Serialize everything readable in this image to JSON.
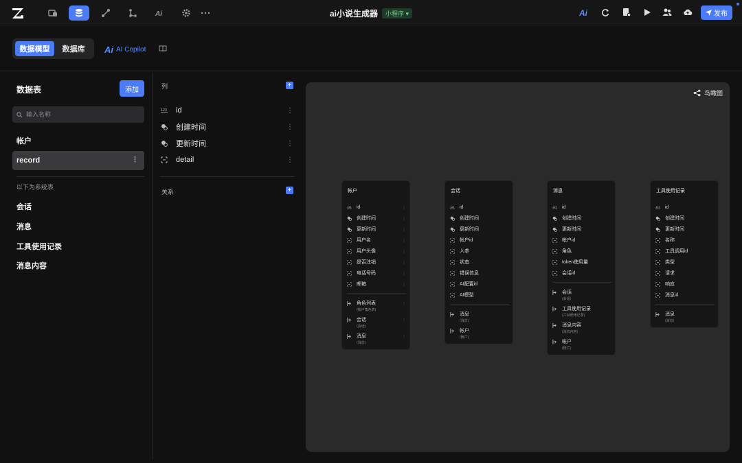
{
  "app": {
    "title": "ai小说生成器",
    "badge": "小程序 ▾",
    "publish": "发布"
  },
  "nav_icons": [
    "pages-icon",
    "database-icon",
    "workflow-icon",
    "logic-icon",
    "ai-icon",
    "settings-icon",
    "more-icon"
  ],
  "subbar": {
    "tab_model": "数据模型",
    "tab_db": "数据库",
    "copilot_ai": "Ai",
    "copilot": "AI Copilot"
  },
  "left": {
    "title": "数据表",
    "add": "添加",
    "search_placeholder": "输入名称",
    "tables": [
      "帐户",
      "record"
    ],
    "system_label": "以下为系统表",
    "system_tables": [
      "会话",
      "消息",
      "工具使用记录",
      "消息内容"
    ]
  },
  "middle": {
    "columns_label": "列",
    "relations_label": "关系",
    "columns": [
      {
        "icon": "number-icon",
        "name": "id"
      },
      {
        "icon": "clock-icon",
        "name": "创建时间"
      },
      {
        "icon": "clock-icon",
        "name": "更新时间"
      },
      {
        "icon": "field-icon",
        "name": "detail"
      }
    ]
  },
  "canvas": {
    "birdview": "鸟瞰图",
    "cards": [
      {
        "title": "帐户",
        "fields": [
          "id",
          "创建时间",
          "更新时间",
          "用户名",
          "用户头像",
          "是否注销",
          "电话号码",
          "邮箱"
        ],
        "relations": [
          {
            "name": "角色列表",
            "sub": "(帐户角色表)"
          },
          {
            "name": "会话",
            "sub": "(会话)"
          },
          {
            "name": "消息",
            "sub": "(消息)"
          }
        ]
      },
      {
        "title": "会话",
        "fields": [
          "id",
          "创建时间",
          "更新时间",
          "帐户id",
          "入参",
          "状态",
          "错误信息",
          "AI配置id",
          "AI模型"
        ],
        "relations": [
          {
            "name": "消息",
            "sub": "(消息)"
          },
          {
            "name": "帐户",
            "sub": "(帐户)"
          }
        ]
      },
      {
        "title": "消息",
        "fields": [
          "id",
          "创建时间",
          "更新时间",
          "帐户id",
          "角色",
          "token使用量",
          "会话id"
        ],
        "relations": [
          {
            "name": "会话",
            "sub": "(会话)"
          },
          {
            "name": "工具使用记录",
            "sub": "(工具使用记录)"
          },
          {
            "name": "消息内容",
            "sub": "(消息内容)"
          },
          {
            "name": "帐户",
            "sub": "(帐户)"
          }
        ]
      },
      {
        "title": "工具使用记录",
        "fields": [
          "id",
          "创建时间",
          "更新时间",
          "名称",
          "工具调用id",
          "类型",
          "请求",
          "响应",
          "消息id"
        ],
        "relations": [
          {
            "name": "消息",
            "sub": "(消息)"
          }
        ]
      }
    ]
  }
}
